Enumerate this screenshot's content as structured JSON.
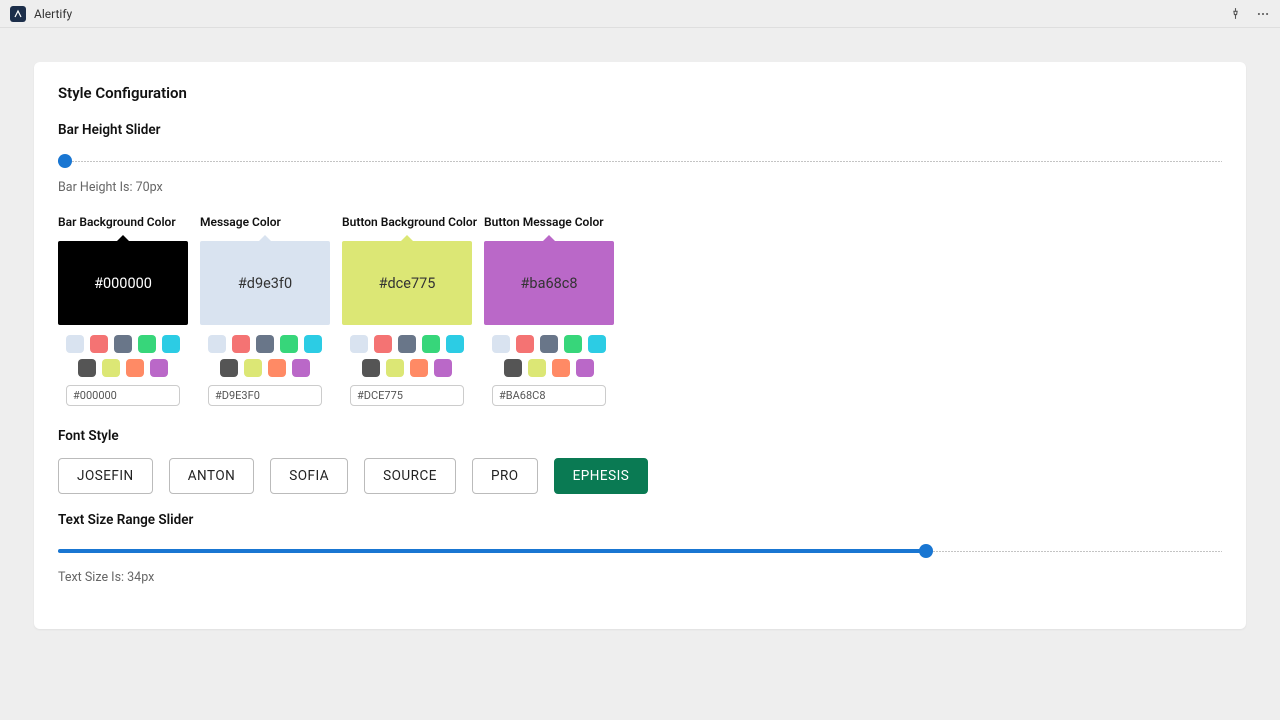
{
  "app": {
    "name": "Alertify"
  },
  "card": {
    "title": "Style Configuration"
  },
  "barHeight": {
    "label": "Bar Height Slider",
    "value": 70,
    "statusPrefix": "Bar Height Is: ",
    "statusSuffix": "px",
    "percent": 0.6
  },
  "textSize": {
    "label": "Text Size Range Slider",
    "value": 34,
    "statusPrefix": "Text Size Is: ",
    "statusSuffix": "px",
    "percent": 74.6
  },
  "colorPalette": [
    "#d9e3f0",
    "#f47373",
    "#697689",
    "#37d67a",
    "#2ccce4",
    "#555555",
    "#dce775",
    "#ff8a65",
    "#ba68c8"
  ],
  "pickers": [
    {
      "id": "bar-bg",
      "label": "Bar Background Color",
      "value": "#000000",
      "inputValue": "#000000",
      "textColor": "#ffffff"
    },
    {
      "id": "message",
      "label": "Message Color",
      "value": "#d9e3f0",
      "inputValue": "#D9E3F0",
      "textColor": "#333333"
    },
    {
      "id": "button-bg",
      "label": "Button Background Color",
      "value": "#dce775",
      "inputValue": "#DCE775",
      "textColor": "#333333"
    },
    {
      "id": "button-msg",
      "label": "Button Message Color",
      "value": "#ba68c8",
      "inputValue": "#BA68C8",
      "textColor": "#333333"
    }
  ],
  "fontStyle": {
    "label": "Font Style",
    "options": [
      "JOSEFIN",
      "ANTON",
      "SOFIA",
      "SOURCE",
      "PRO",
      "EPHESIS"
    ],
    "active": "EPHESIS"
  }
}
